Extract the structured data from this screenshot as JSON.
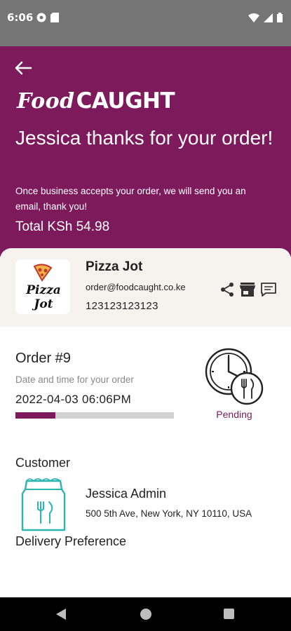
{
  "status_bar": {
    "time": "6:06"
  },
  "header": {
    "logo_food": "Food",
    "logo_caught": "CAUGHT",
    "thanks": "Jessica thanks for your order!",
    "subtitle": "Once business accepts your order, we will send you an email, thank you!",
    "total": "Total KSh 54.98",
    "background": "#7d1a5b"
  },
  "business": {
    "name": "Pizza Jot",
    "email": "order@foodcaught.co.ke",
    "phone": "123123123123",
    "logo_text": "Pizza Jot"
  },
  "order": {
    "title": "Order #9",
    "date_label": "Date and time for your order",
    "date": "2022-04-03 06:06PM",
    "progress": 0.25,
    "status": "Pending"
  },
  "customer": {
    "section_title": "Customer",
    "name": "Jessica Admin",
    "address": "500 5th Ave, New York, NY 10110, USA"
  },
  "delivery": {
    "section_title": "Delivery Preference"
  },
  "colors": {
    "accent": "#7d1a5b",
    "teal": "#2bb6b0"
  }
}
